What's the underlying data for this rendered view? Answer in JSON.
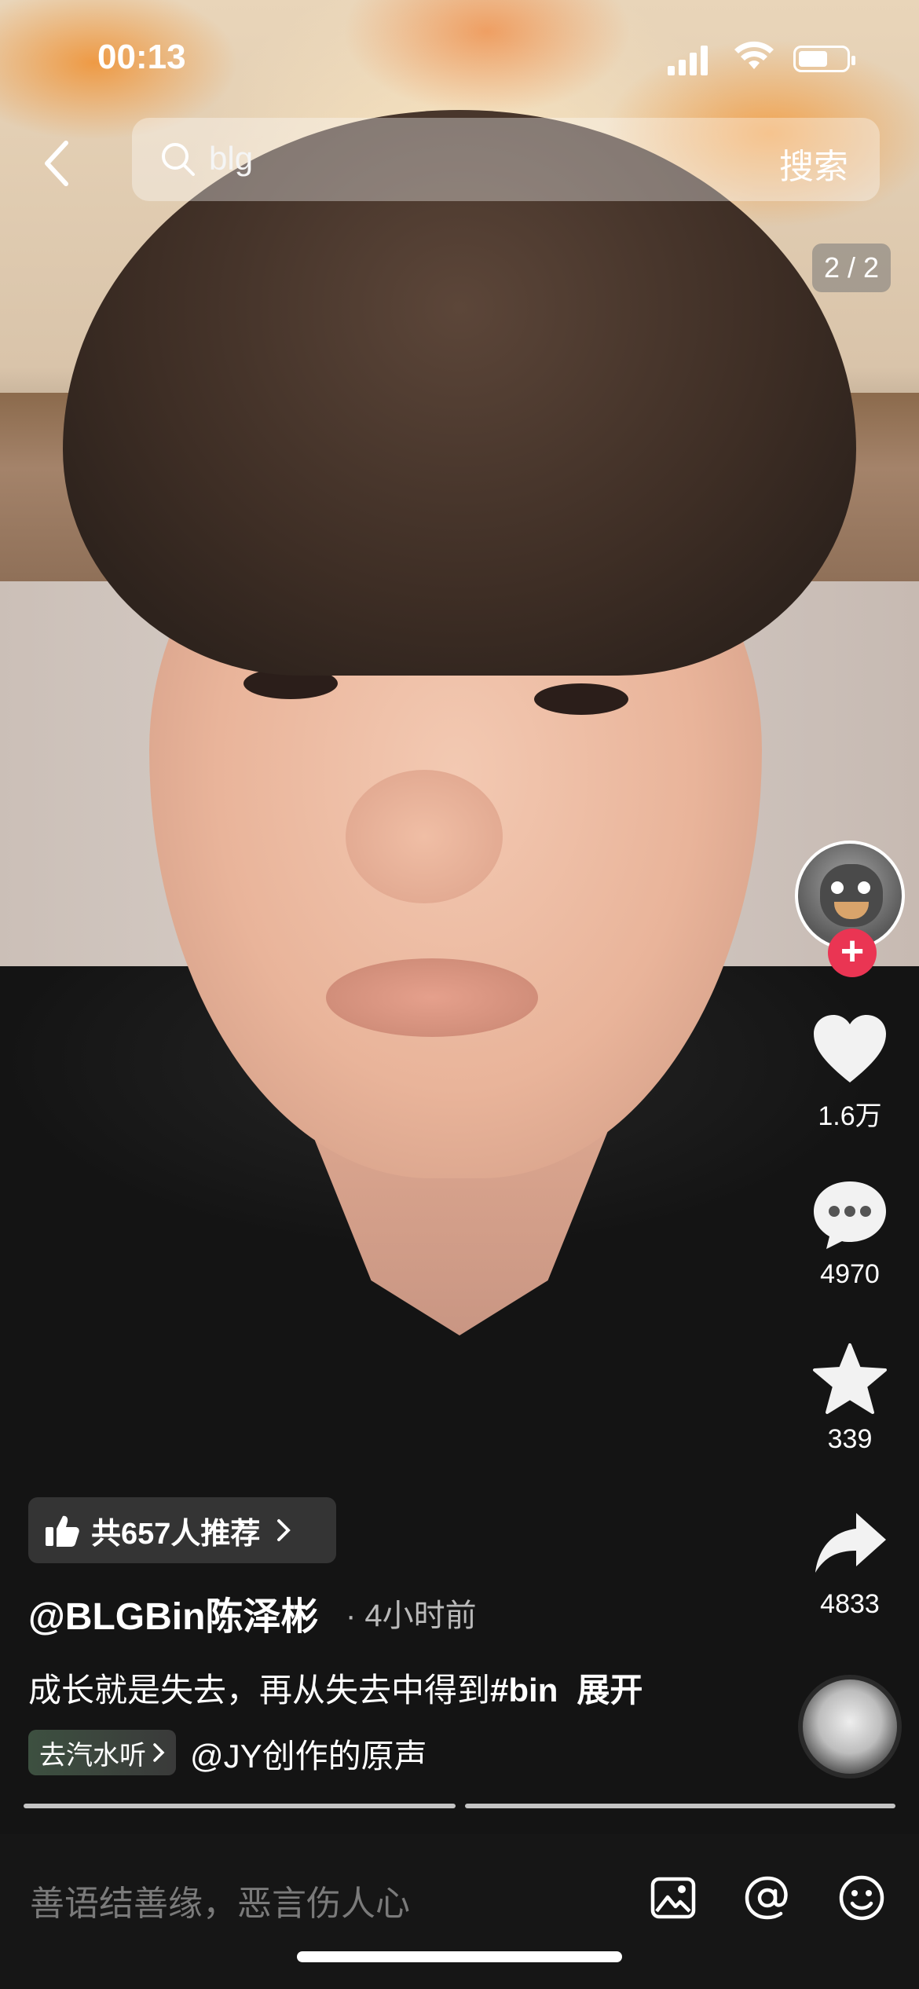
{
  "status_bar": {
    "time": "00:13"
  },
  "search": {
    "query": "blg",
    "button_label": "搜索"
  },
  "page_indicator": "2 / 2",
  "actions": {
    "likes": "1.6万",
    "comments": "4970",
    "favorites": "339",
    "shares": "4833"
  },
  "recommend": {
    "label": "共657人推荐"
  },
  "author": {
    "name": "@BLGBin陈泽彬",
    "posted": "· 4小时前"
  },
  "caption": {
    "text": "成长就是失去，再从失去中得到",
    "hashtag": "#bin",
    "expand": "展开"
  },
  "music": {
    "chip_label": "去汽水听",
    "source": "@JY创作的原声"
  },
  "comment_bar": {
    "placeholder": "善语结善缘，恶言伤人心"
  },
  "colors": {
    "follow_red": "#ea3553",
    "chip_green": "#3d5040"
  },
  "icons": [
    "back-icon",
    "search-icon",
    "heart-icon",
    "comment-icon",
    "star-icon",
    "share-icon",
    "thumbs-up-icon",
    "image-icon",
    "at-icon",
    "emoji-icon"
  ]
}
